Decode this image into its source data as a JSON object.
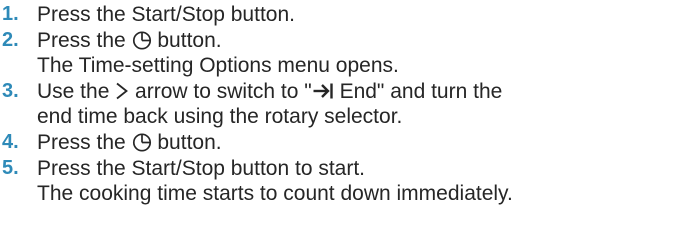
{
  "steps": [
    {
      "number": "1.",
      "segments": [
        {
          "type": "text",
          "value": "Press the Start/Stop button."
        }
      ]
    },
    {
      "number": "2.",
      "segments": [
        {
          "type": "text",
          "value": "Press the "
        },
        {
          "type": "icon",
          "icon": "timer-icon"
        },
        {
          "type": "text",
          "value": " button."
        }
      ],
      "result": "The Time-setting Options menu opens."
    },
    {
      "number": "3.",
      "segments": [
        {
          "type": "text",
          "value": "Use the "
        },
        {
          "type": "icon",
          "icon": "chevron-right-icon"
        },
        {
          "type": "text",
          "value": " arrow to switch to \""
        },
        {
          "type": "icon",
          "icon": "arrow-to-end-icon"
        },
        {
          "type": "text",
          "value": " End\" and turn the"
        }
      ],
      "continuation": "end time back using the rotary selector."
    },
    {
      "number": "4.",
      "segments": [
        {
          "type": "text",
          "value": "Press the "
        },
        {
          "type": "icon",
          "icon": "timer-icon"
        },
        {
          "type": "text",
          "value": " button."
        }
      ]
    },
    {
      "number": "5.",
      "segments": [
        {
          "type": "text",
          "value": "Press the Start/Stop button to start."
        }
      ],
      "result": "The cooking time starts to count down immediately."
    }
  ],
  "colors": {
    "step_number": "#2e8ab8",
    "text": "#262626"
  }
}
